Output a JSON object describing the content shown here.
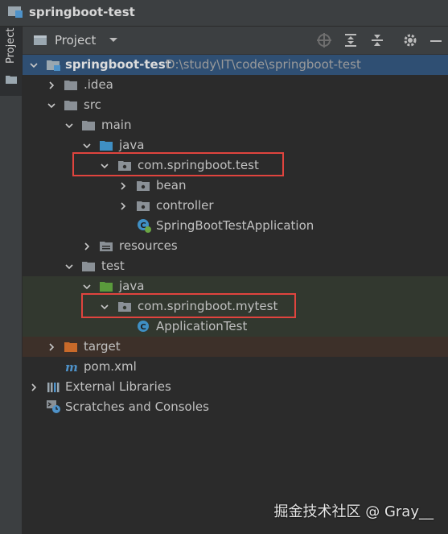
{
  "window": {
    "title": "springboot-test"
  },
  "side_tab": {
    "label": "Project"
  },
  "toolbar": {
    "view_label": "Project"
  },
  "tree": {
    "root": {
      "name": "springboot-test",
      "path": "D:\\study\\IT\\code\\springboot-test"
    },
    "idea": ".idea",
    "src": "src",
    "main": "main",
    "main_java": "java",
    "main_package": "com.springboot.test",
    "bean": "bean",
    "controller": "controller",
    "main_class": "SpringBootTestApplication",
    "resources": "resources",
    "test": "test",
    "test_java": "java",
    "test_package": "com.springboot.mytest",
    "test_class": "ApplicationTest",
    "target": "target",
    "pom": "pom.xml",
    "ext_libs": "External Libraries",
    "scratches": "Scratches and Consoles"
  },
  "watermark": "掘金技术社区 @ Gray__",
  "colors": {
    "selection": "#2f4f73",
    "test_sources": "#32382f",
    "excluded": "#3d3029",
    "highlight_box": "#e0443e",
    "folder_gray": "#8a9096",
    "folder_blue": "#3f8fc4",
    "folder_green": "#5a9a3c",
    "folder_orange": "#c96a2a"
  }
}
